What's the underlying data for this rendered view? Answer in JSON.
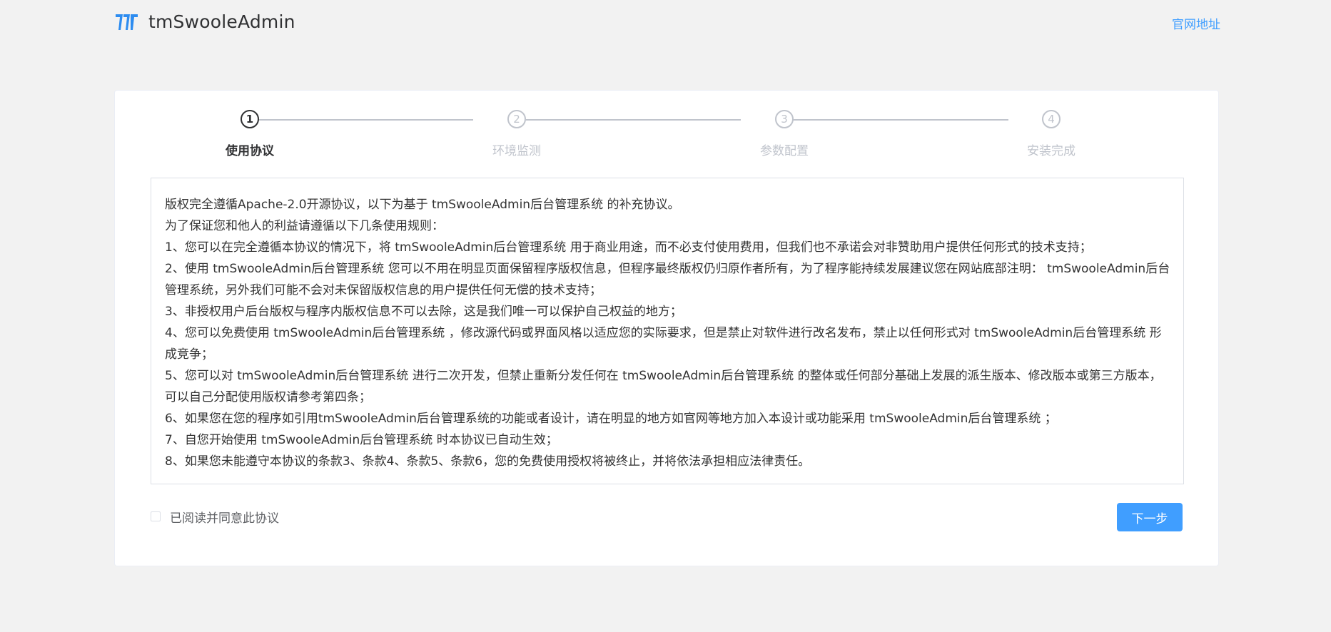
{
  "header": {
    "app_title": "tmSwooleAdmin",
    "official_link": "官网地址"
  },
  "steps": [
    {
      "number": "1",
      "title": "使用协议",
      "active": true
    },
    {
      "number": "2",
      "title": "环境监测",
      "active": false
    },
    {
      "number": "3",
      "title": "参数配置",
      "active": false
    },
    {
      "number": "4",
      "title": "安装完成",
      "active": false
    }
  ],
  "agreement": {
    "lines": [
      "版权完全遵循Apache-2.0开源协议，以下为基于 tmSwooleAdmin后台管理系统 的补充协议。",
      "为了保证您和他人的利益请遵循以下几条使用规则：",
      "1、您可以在完全遵循本协议的情况下，将 tmSwooleAdmin后台管理系统 用于商业用途，而不必支付使用费用，但我们也不承诺会对非赞助用户提供任何形式的技术支持；",
      "2、使用 tmSwooleAdmin后台管理系统 您可以不用在明显页面保留程序版权信息，但程序最终版权仍归原作者所有，为了程序能持续发展建议您在网站底部注明： tmSwooleAdmin后台管理系统，另外我们可能不会对未保留版权信息的用户提供任何无偿的技术支持；",
      "3、非授权用户后台版权与程序内版权信息不可以去除，这是我们唯一可以保护自己权益的地方；",
      "4、您可以免费使用 tmSwooleAdmin后台管理系统 ，修改源代码或界面风格以适应您的实际要求，但是禁止对软件进行改名发布，禁止以任何形式对 tmSwooleAdmin后台管理系统 形成竞争；",
      "5、您可以对 tmSwooleAdmin后台管理系统 进行二次开发，但禁止重新分发任何在 tmSwooleAdmin后台管理系统 的整体或任何部分基础上发展的派生版本、修改版本或第三方版本，可以自己分配使用版权请参考第四条；",
      "6、如果您在您的程序如引用tmSwooleAdmin后台管理系统的功能或者设计，请在明显的地方如官网等地方加入本设计或功能采用 tmSwooleAdmin后台管理系统 ；",
      "7、自您开始使用 tmSwooleAdmin后台管理系统 时本协议已自动生效；",
      "8、如果您未能遵守本协议的条款3、条款4、条款5、条款6，您的免费使用授权将被终止，并将依法承担相应法律责任。"
    ]
  },
  "agree_checkbox": {
    "label": "已阅读并同意此协议",
    "checked": false
  },
  "next_button": {
    "label": "下一步"
  },
  "colors": {
    "primary": "#409eff",
    "page_background": "#f2f2f2",
    "step_active": "#303133",
    "step_inactive": "#c0c4cc"
  }
}
